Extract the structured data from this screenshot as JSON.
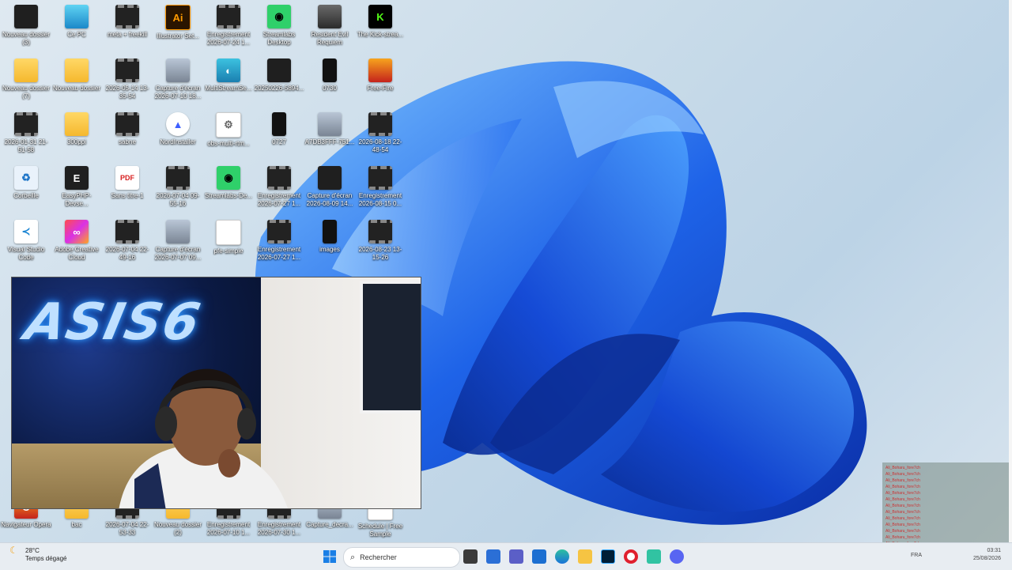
{
  "desktop": {
    "icons": [
      {
        "label": "Nouveau dossier (3)",
        "type": "dark",
        "glyph": ""
      },
      {
        "label": "Ce PC",
        "type": "pc",
        "glyph": ""
      },
      {
        "label": "meta + freekill",
        "type": "video",
        "glyph": ""
      },
      {
        "label": "Illustrator Set...",
        "type": "ai",
        "glyph": "Ai"
      },
      {
        "label": "Enregistrement 2026-07-24 1...",
        "type": "video",
        "glyph": ""
      },
      {
        "label": "Streamlabs Desktop",
        "type": "green",
        "glyph": "◉"
      },
      {
        "label": "Resident Evil Requiem",
        "type": "re",
        "glyph": ""
      },
      {
        "label": "The Kick-strea...",
        "type": "kick",
        "glyph": "K"
      },
      {
        "label": "Nouveau dossier (7)",
        "type": "folder",
        "glyph": ""
      },
      {
        "label": "Nouveau dossier",
        "type": "folder",
        "glyph": ""
      },
      {
        "label": "2026-05-14 13-35-54",
        "type": "video",
        "glyph": ""
      },
      {
        "label": "Capture d'écran 2026-07-10 18...",
        "type": "photo",
        "glyph": ""
      },
      {
        "label": "MultiStreamSe...",
        "type": "multi",
        "glyph": "◐"
      },
      {
        "label": "20250226-5894...",
        "type": "dark",
        "glyph": ""
      },
      {
        "label": "0730",
        "type": "phone",
        "glyph": ""
      },
      {
        "label": "Free-Fire",
        "type": "ff",
        "glyph": ""
      },
      {
        "label": "2026-01-31 21-51-58",
        "type": "video",
        "glyph": ""
      },
      {
        "label": "300ppi",
        "type": "folder",
        "glyph": ""
      },
      {
        "label": "sabne",
        "type": "video",
        "glyph": ""
      },
      {
        "label": "NordInstaller",
        "type": "nord",
        "glyph": "▲"
      },
      {
        "label": "obs-multi-rtm...",
        "type": "doc",
        "glyph": "⚙"
      },
      {
        "label": "0727",
        "type": "phone",
        "glyph": ""
      },
      {
        "label": "A7DB3FFF-751...",
        "type": "photo",
        "glyph": ""
      },
      {
        "label": "2026-08-18 22-48-54",
        "type": "video",
        "glyph": ""
      },
      {
        "label": "Corbeille",
        "type": "recycle",
        "glyph": "♻"
      },
      {
        "label": "EasyPHP-Devse...",
        "type": "dark",
        "glyph": "E"
      },
      {
        "label": "Sans titre-1",
        "type": "pdf",
        "glyph": "PDF"
      },
      {
        "label": "2026-07-04 09-55-16",
        "type": "video",
        "glyph": ""
      },
      {
        "label": "Streamlabs-De...",
        "type": "green",
        "glyph": "◉"
      },
      {
        "label": "Enregistrement 2026-07-27 1...",
        "type": "video",
        "glyph": ""
      },
      {
        "label": "Capture d'écran 2026-08-09 14...",
        "type": "dark",
        "glyph": ""
      },
      {
        "label": "Enregistrement 2026-08-15 0...",
        "type": "video",
        "glyph": ""
      },
      {
        "label": "Visual Studio Code",
        "type": "vscode",
        "glyph": "≺"
      },
      {
        "label": "Adobe Creative Cloud",
        "type": "adobe",
        "glyph": "∞"
      },
      {
        "label": "2026-07-04 22-49-16",
        "type": "video",
        "glyph": ""
      },
      {
        "label": "Capture d'écran 2026-07-07 09...",
        "type": "photo",
        "glyph": ""
      },
      {
        "label": "pfe-simple",
        "type": "doc",
        "glyph": ""
      },
      {
        "label": "Enregistrement 2026-07-27 1...",
        "type": "video",
        "glyph": ""
      },
      {
        "label": "images",
        "type": "phone",
        "glyph": ""
      },
      {
        "label": "2026-08-23 13-15-26",
        "type": "video",
        "glyph": ""
      }
    ],
    "bottom_icons": [
      {
        "label": "Navigateur Opera",
        "type": "ff",
        "glyph": "O"
      },
      {
        "label": "bac",
        "type": "folder",
        "glyph": ""
      },
      {
        "label": "2026-07-04 22-53-33",
        "type": "video",
        "glyph": ""
      },
      {
        "label": "Nouveau dossier (2)",
        "type": "folder",
        "glyph": ""
      },
      {
        "label": "Enregistrement 2026-07-10 1...",
        "type": "video",
        "glyph": ""
      },
      {
        "label": "Enregistrement 2026-07-30 1...",
        "type": "video",
        "glyph": ""
      },
      {
        "label": "Capture_decra...",
        "type": "photo",
        "glyph": ""
      },
      {
        "label": "Schedule | Free Sample",
        "type": "doc",
        "glyph": ""
      }
    ]
  },
  "webcam": {
    "neon_text": "ASIS6"
  },
  "taskbar": {
    "weather_temp": "28°C",
    "weather_desc": "Temps dégagé",
    "search_placeholder": "Rechercher",
    "language": "FRA",
    "time": "03:31",
    "date": "25/08/2026",
    "apps": [
      "start-icon",
      "search-icon",
      "task-view-icon",
      "store-icon",
      "teams-icon",
      "mail-icon",
      "edge-icon",
      "file-explorer-icon",
      "photoshop-icon",
      "opera-icon",
      "streamlabs-icon",
      "discord-icon"
    ]
  },
  "chat": {
    "user": "Ali_Boharu_fore7ch",
    "lines": [
      "Ali_Boharu_fore7ch",
      "Ali_Boharu_fore7ch",
      "Ali_Boharu_fore7ch",
      "Ali_Boharu_fore7ch",
      "Ali_Boharu_fore7ch",
      "Ali_Boharu_fore7ch",
      "Ali_Boharu_fore7ch",
      "Ali_Boharu_fore7ch",
      "Ali_Boharu_fore7ch",
      "Ali_Boharu_fore7ch",
      "Ali_Boharu_fore7ch",
      "Ali_Boharu_fore7ch",
      "Ali_Boharu_fore7ch",
      "Ali_Boharu_fore7ch",
      "Ali_Boharu_fore7ch",
      "Ali_Boharu_fore7ch"
    ]
  },
  "colors": {
    "bloom_dark": "#0a2fa8",
    "bloom_mid": "#1e63e8",
    "bloom_light": "#6fb5ff",
    "taskbar_bg": "#e8edf2"
  }
}
